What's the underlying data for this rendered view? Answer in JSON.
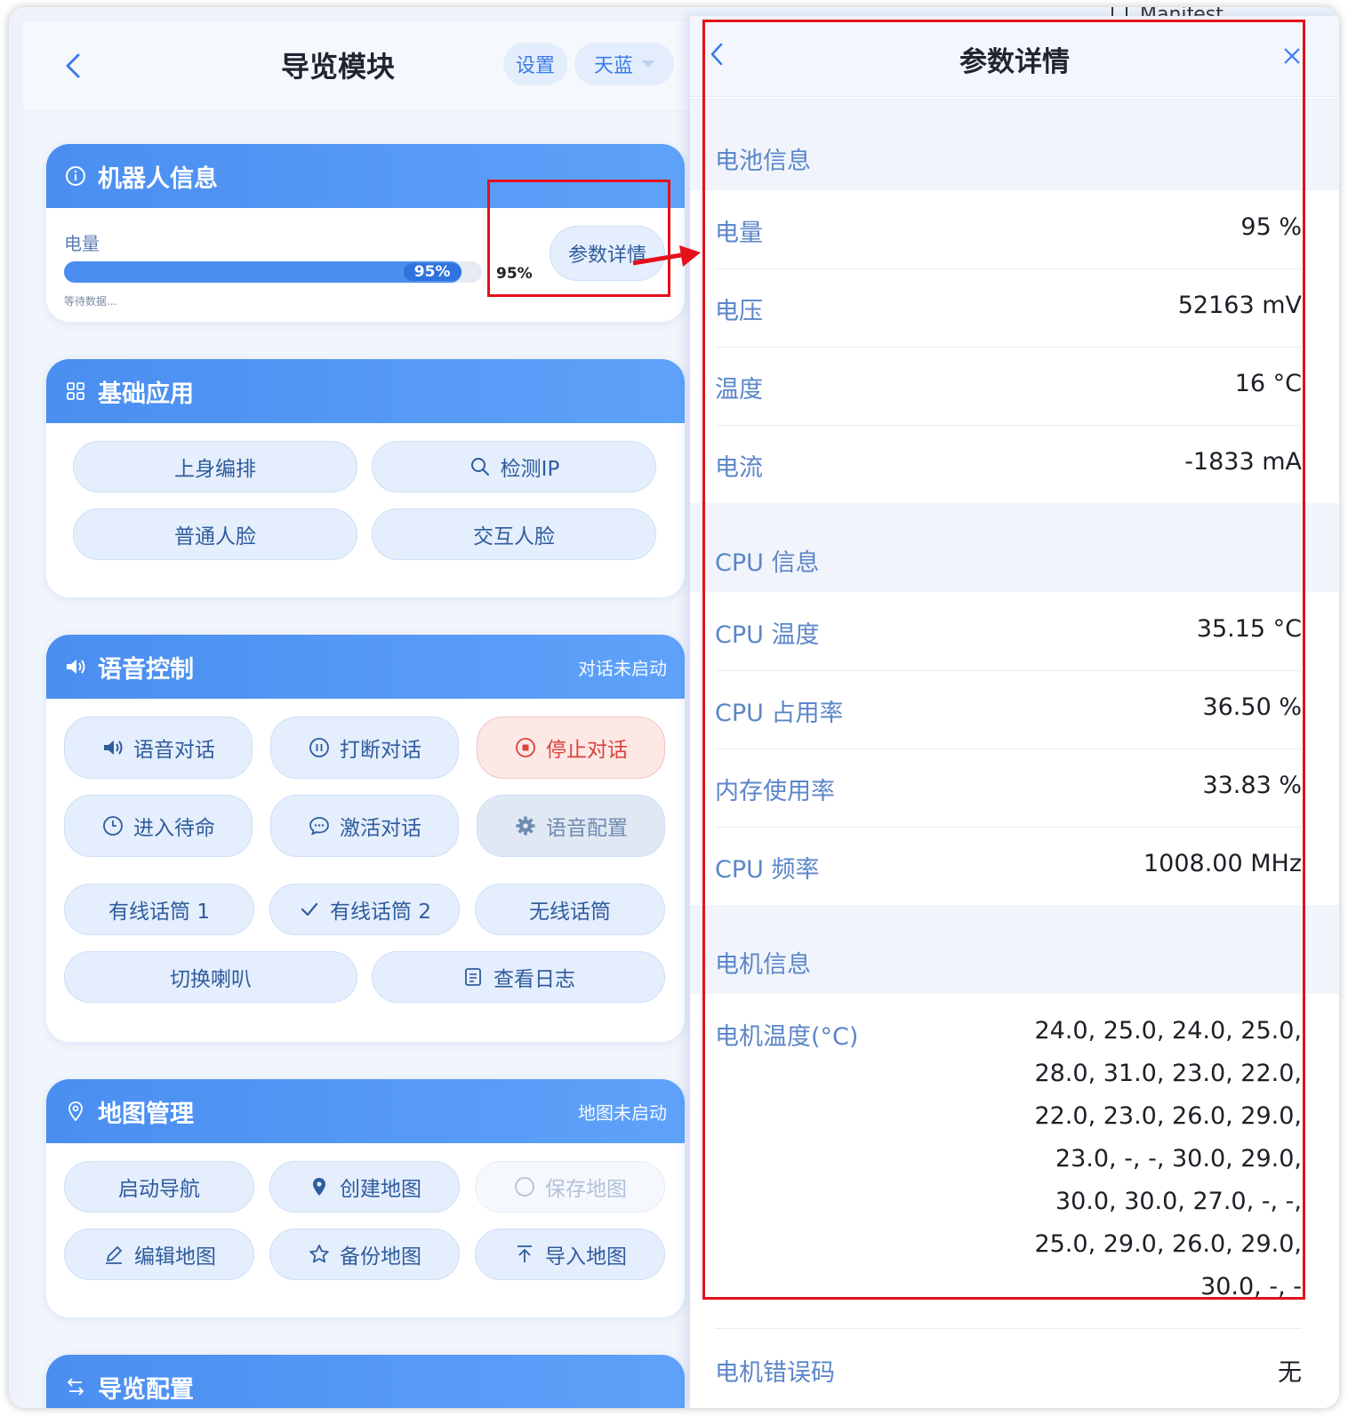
{
  "app": {
    "nav_title": "导览模块",
    "settings_label": "设置",
    "theme_label": "天蓝"
  },
  "robot_info": {
    "title": "机器人信息",
    "battery_label": "电量",
    "battery_percent": 95,
    "battery_text": "95%",
    "battery_text_alt": "95%",
    "waiting_text": "等待数据...",
    "details_button": "参数详情"
  },
  "basic_apps": {
    "title": "基础应用",
    "buttons": [
      "上身编排",
      "检测IP",
      "普通人脸",
      "交互人脸"
    ]
  },
  "voice_control": {
    "title": "语音控制",
    "status": "对话未启动",
    "buttons": [
      "语音对话",
      "打断对话",
      "停止对话",
      "进入待命",
      "激活对话",
      "语音配置",
      "有线话筒 1",
      "有线话筒 2",
      "无线话筒",
      "切换喇叭",
      "查看日志"
    ]
  },
  "map_management": {
    "title": "地图管理",
    "status": "地图未启动",
    "buttons": [
      "启动导航",
      "创建地图",
      "保存地图",
      "编辑地图",
      "备份地图",
      "导入地图"
    ]
  },
  "tour_config": {
    "title": "导览配置"
  },
  "details_panel": {
    "title": "参数详情",
    "battery_section": "电池信息",
    "battery_rows": [
      {
        "label": "电量",
        "value": "95 %"
      },
      {
        "label": "电压",
        "value": "52163 mV"
      },
      {
        "label": "温度",
        "value": "16 °C"
      },
      {
        "label": "电流",
        "value": "-1833 mA"
      }
    ],
    "cpu_section": "CPU 信息",
    "cpu_rows": [
      {
        "label": "CPU 温度",
        "value": "35.15 °C"
      },
      {
        "label": "CPU 占用率",
        "value": "36.50 %"
      },
      {
        "label": "内存使用率",
        "value": "33.83 %"
      },
      {
        "label": "CPU 频率",
        "value": "1008.00 MHz"
      }
    ],
    "motor_section": "电机信息",
    "motor_temp_label": "电机温度(°C)",
    "motor_temp_lines": [
      "24.0, 25.0, 24.0, 25.0,",
      "28.0, 31.0, 23.0, 22.0,",
      "22.0, 23.0, 26.0, 29.0,",
      "23.0, -, -, 30.0, 29.0,",
      "30.0, 30.0, 27.0, -, -,",
      "25.0, 29.0, 26.0, 29.0,",
      "30.0, -, -"
    ],
    "motor_error_label": "电机错误码",
    "motor_error_value": "无"
  },
  "background_text": "Manifest",
  "colors": {
    "accent": "#4a8ef0",
    "annotation_red": "#e5101a",
    "danger": "#d9443b"
  }
}
